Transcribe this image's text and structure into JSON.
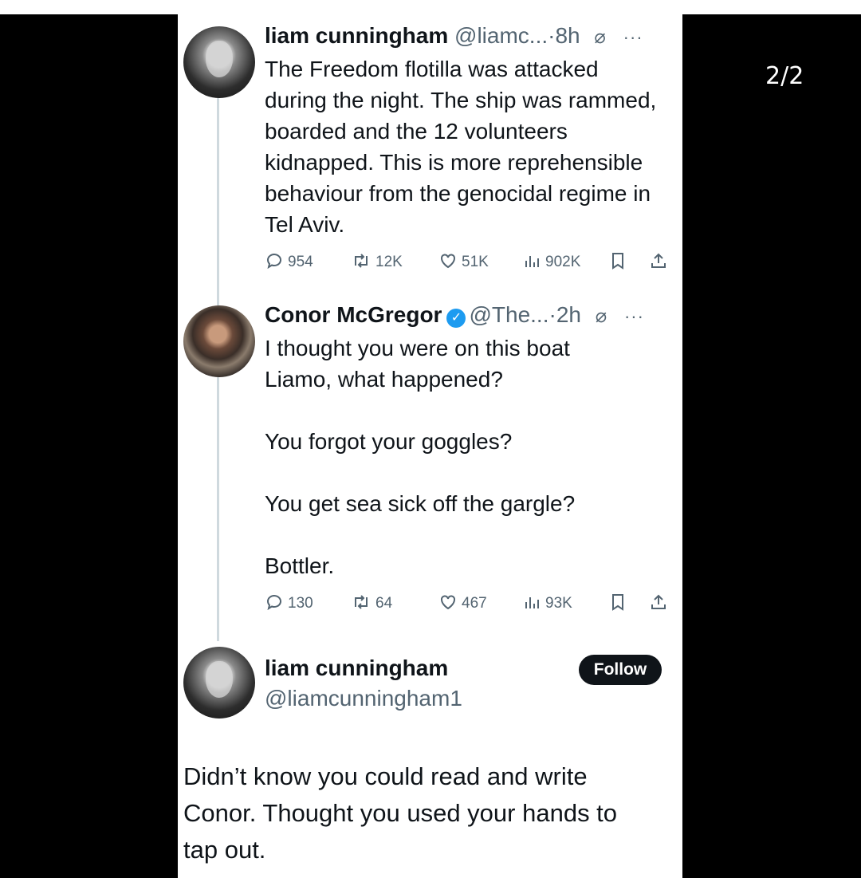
{
  "page_counter": "2/2",
  "tweets": [
    {
      "name": "liam cunningham",
      "handle": "@liamc...",
      "time": "8h",
      "text": "The Freedom flotilla was attacked during the night. The ship was rammed, boarded and the 12 volunteers kidnapped. This is more reprehensible behaviour from the genocidal regime in Tel Aviv.",
      "stats": {
        "replies": "954",
        "reposts": "12K",
        "likes": "51K",
        "views": "902K"
      }
    },
    {
      "name": "Conor McGregor",
      "handle": "@The...",
      "time": "2h",
      "text": "I thought you were on this boat\nLiamo, what happened?\n\nYou forgot your goggles?\n\nYou get sea sick off the gargle?\n\nBottler.",
      "stats": {
        "replies": "130",
        "reposts": "64",
        "likes": "467",
        "views": "93K"
      }
    }
  ],
  "reply": {
    "name": "liam cunningham",
    "handle": "@liamcunningham1",
    "follow_label": "Follow",
    "text": "Didn’t know you could read and write\nConor. Thought you used your hands to\ntap out."
  },
  "colors": {
    "text": "#0f1419",
    "muted": "#536471",
    "verified": "#1d9bf0",
    "thread": "#cfd9de"
  },
  "icons": [
    "reply-icon",
    "repost-icon",
    "like-icon",
    "views-icon",
    "bookmark-icon",
    "share-icon",
    "verified-badge-icon",
    "more-icon"
  ]
}
